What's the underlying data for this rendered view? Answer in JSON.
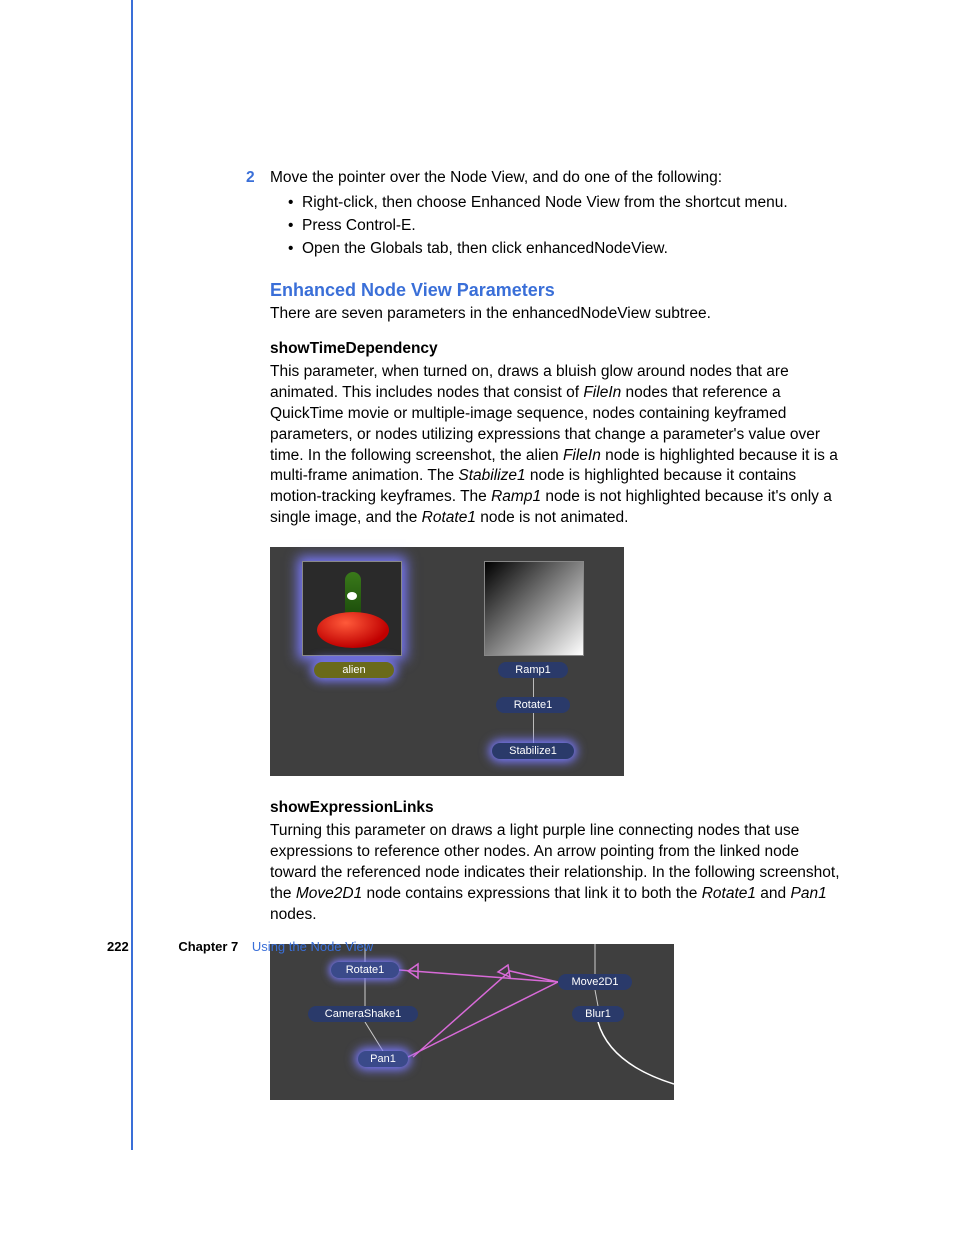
{
  "step": {
    "number": "2",
    "text": "Move the pointer over the Node View, and do one of the following:",
    "bullets": [
      "Right-click, then choose Enhanced Node View from the shortcut menu.",
      "Press Control-E.",
      "Open the Globals tab, then click enhancedNodeView."
    ]
  },
  "section": {
    "heading": "Enhanced Node View Parameters",
    "intro": "There are seven parameters in the enhancedNodeView subtree."
  },
  "param1": {
    "name": "showTimeDependency",
    "text_parts": {
      "a": "This parameter, when turned on, draws a bluish glow around nodes that are animated. This includes nodes that consist of ",
      "b": " nodes that reference a QuickTime movie or multiple-image sequence, nodes containing keyframed parameters, or nodes utilizing expressions that change a parameter's value over time. In the following screenshot, the alien ",
      "c": " node is highlighted because it is a multi-frame animation. The ",
      "d": " node is highlighted because it contains motion-tracking keyframes. The ",
      "e": " node is not highlighted because it's only a single image, and the ",
      "f": " node is not animated."
    },
    "italics": {
      "filein1": "FileIn",
      "filein2": "FileIn",
      "stabilize": "Stabilize1",
      "ramp": "Ramp1",
      "rotate": "Rotate1"
    }
  },
  "fig1_labels": {
    "alien": "alien",
    "ramp": "Ramp1",
    "rotate": "Rotate1",
    "stabilize": "Stabilize1"
  },
  "param2": {
    "name": "showExpressionLinks",
    "text_parts": {
      "a": "Turning this parameter on draws a light purple line connecting nodes that use expressions to reference other nodes. An arrow pointing from the linked node toward the referenced node indicates their relationship. In the following screenshot, the ",
      "b": " node contains expressions that link it to both the ",
      "c": " and ",
      "d": " nodes."
    },
    "italics": {
      "move": "Move2D1",
      "rotate": "Rotate1",
      "pan": "Pan1"
    }
  },
  "fig2_labels": {
    "rotate": "Rotate1",
    "move": "Move2D1",
    "camera": "CameraShake1",
    "blur": "Blur1",
    "pan": "Pan1"
  },
  "footer": {
    "page": "222",
    "chapter": "Chapter 7",
    "title": "Using the Node View"
  }
}
